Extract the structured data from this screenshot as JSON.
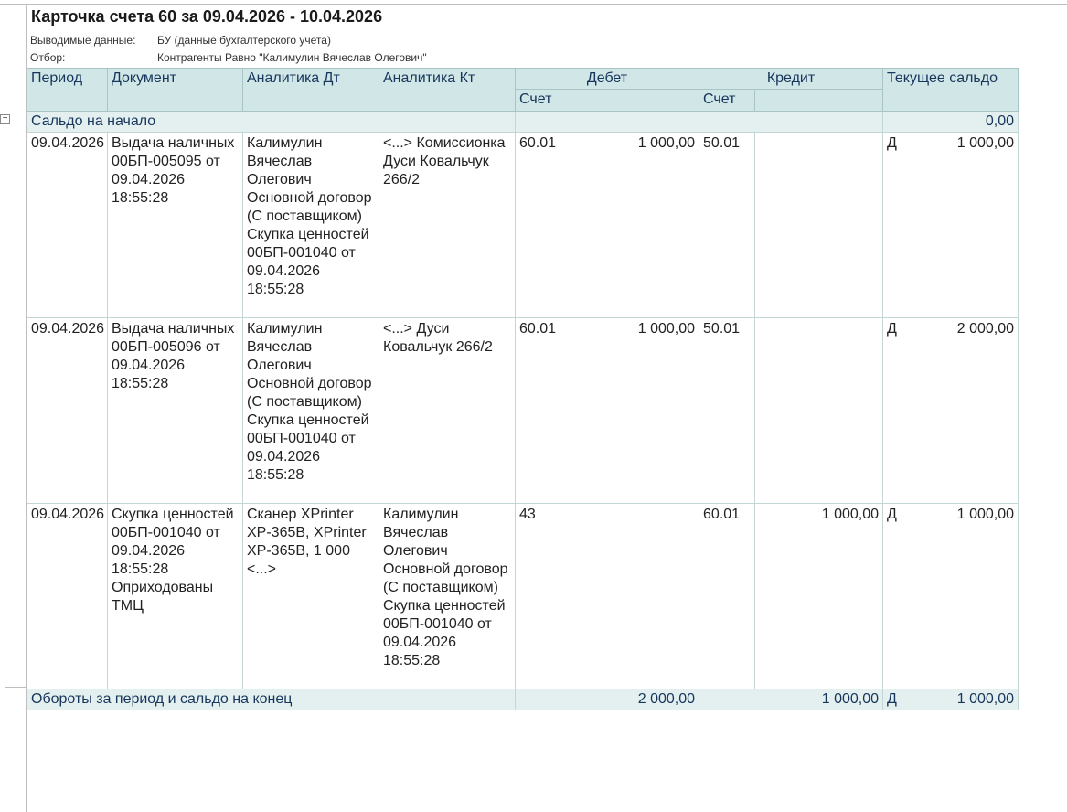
{
  "report": {
    "title": "Карточка счета 60 за 09.04.2026 - 10.04.2026",
    "params": [
      {
        "label": "Выводимые данные:",
        "value": "БУ (данные бухгалтерского учета)"
      },
      {
        "label": "Отбор:",
        "value": "Контрагенты Равно \"Калимулин Вячеслав Олегович\""
      }
    ]
  },
  "table": {
    "headers": {
      "period": "Период",
      "document": "Документ",
      "analytics_dt": "Аналитика Дт",
      "analytics_kt": "Аналитика Кт",
      "debit": "Дебет",
      "credit": "Кредит",
      "balance": "Текущее сальдо",
      "debit_account": "Счет",
      "credit_account": "Счет"
    },
    "opening": {
      "label": "Сальдо на начало",
      "value": "0,00"
    },
    "rows": [
      {
        "period": "09.04.2026",
        "document": "Выдача наличных 00БП-005095 от 09.04.2026 18:55:28",
        "analytics_dt": "Калимулин Вячеслав Олегович Основной договор (С поставщиком) Скупка ценностей 00БП-001040 от 09.04.2026 18:55:28",
        "analytics_kt": "<...> Комиссионка Дуси Ковальчук 266/2",
        "debit_account": "60.01",
        "debit_amount": "1 000,00",
        "credit_account": "50.01",
        "credit_amount": "",
        "balance_type": "Д",
        "balance": "1 000,00"
      },
      {
        "period": "09.04.2026",
        "document": "Выдача наличных 00БП-005096 от 09.04.2026 18:55:28",
        "analytics_dt": "Калимулин Вячеслав Олегович Основной договор (С поставщиком) Скупка ценностей 00БП-001040 от 09.04.2026 18:55:28",
        "analytics_kt": "<...> Дуси Ковальчук 266/2",
        "debit_account": "60.01",
        "debit_amount": "1 000,00",
        "credit_account": "50.01",
        "credit_amount": "",
        "balance_type": "Д",
        "balance": "2 000,00"
      },
      {
        "period": "09.04.2026",
        "document": "Скупка ценностей 00БП-001040 от 09.04.2026 18:55:28 Оприходованы ТМЦ",
        "analytics_dt": "Сканер XPrinter XP-365B, XPrinter XP-365B, 1 000 <...>",
        "analytics_kt": "Калимулин Вячеслав Олегович Основной договор (С поставщиком) Скупка ценностей 00БП-001040 от 09.04.2026 18:55:28",
        "debit_account": "43",
        "debit_amount": "",
        "credit_account": "60.01",
        "credit_amount": "1 000,00",
        "balance_type": "Д",
        "balance": "1 000,00"
      }
    ],
    "totals": {
      "label": "Обороты за период и сальдо на конец",
      "debit": "2 000,00",
      "credit": "1 000,00",
      "balance_type": "Д",
      "balance": "1 000,00"
    }
  }
}
